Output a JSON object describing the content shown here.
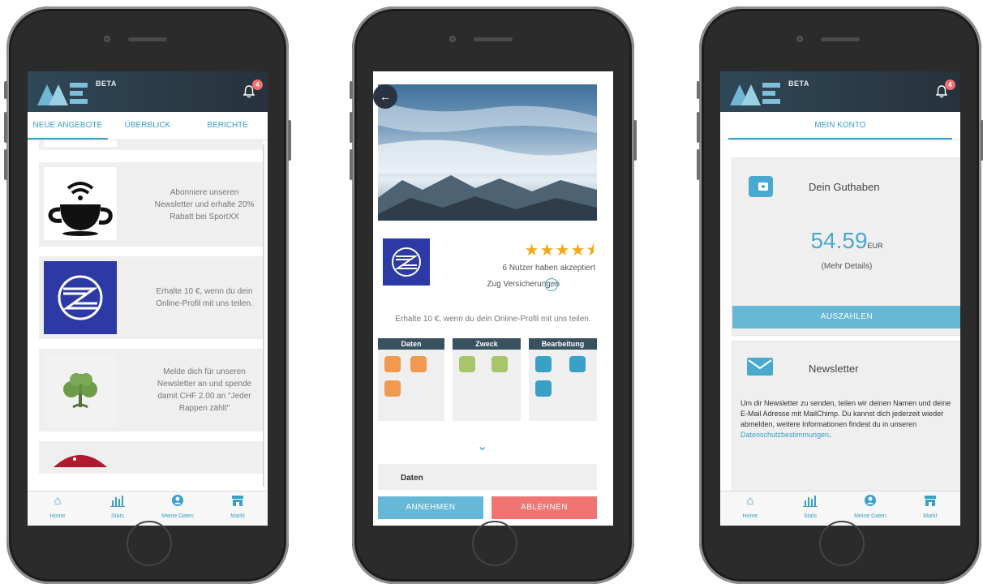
{
  "app": {
    "beta_label": "BETA",
    "notification_count": "4"
  },
  "phone1": {
    "tabs": [
      "NEUE ANGEBOTE",
      "ÜBERBLICK",
      "BERICHTE"
    ],
    "offers": [
      {
        "text": "Abonniere unseren Newsletter und erhalte 20% Rabatt bei SportXX",
        "icon": "coffee-cup-wifi-icon"
      },
      {
        "text": "Erhalte 10 €, wenn du dein Online-Profil mit uns teilen.",
        "icon": "zug-logo"
      },
      {
        "text": "Melde dich für unseren Newsletter an und spende damit CHF 2.00 an \"Jeder Rappen zählt\"",
        "icon": "tree-icon"
      }
    ]
  },
  "nav": {
    "items": [
      "Home",
      "Stats",
      "Meine Daten",
      "Markt"
    ]
  },
  "phone2": {
    "rating_text": "6 Nutzer haben akzeptiert",
    "company": "Zug Versicherungen",
    "description": "Erhalte 10 €, wenn du dein Online-Profil mit uns teilen.",
    "sections": [
      "Daten",
      "Zweck",
      "Bearbeitung"
    ],
    "detail_heading": "Daten",
    "accept": "ANNEHMEN",
    "decline": "ABLEHNEN",
    "colors": {
      "accept": "#67b8d6",
      "decline": "#f07474"
    }
  },
  "phone3": {
    "tab": "MEIN KONTO",
    "balance_title": "Dein Guthaben",
    "balance_value": "54.59",
    "balance_unit": "EUR",
    "balance_details": "(Mehr Details)",
    "payout": "AUSZAHLEN",
    "newsletter_title": "Newsletter",
    "newsletter_text": "Um dir Newsletter zu senden, teilen wir deinen Namen und deine E-Mail Adresse mit MailChimp. Du kannst dich jederzeit wieder abmelden, weitere Informationen findest du in unseren ",
    "newsletter_link": "Datenschutzbestimmungen",
    "newsletter_end": "."
  }
}
